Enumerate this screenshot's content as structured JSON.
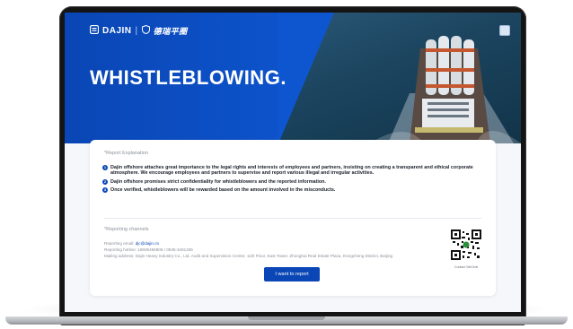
{
  "brand": {
    "logo_text": "DAJIN",
    "separator": "|",
    "logo_cn": "德瑞平圈"
  },
  "hero": {
    "title": "WHISTLEBLOWING",
    "title_dot": "."
  },
  "report_explanation": {
    "label": "*Report Explanation",
    "points": [
      {
        "num": "1",
        "text": "Dajin offshore attaches great importance to the legal rights and interests of employees and partners, insisting on creating a transparent and ethical corporate atmosphere. We encourage employees and partners to supervise and report various illegal and irregular activities."
      },
      {
        "num": "2",
        "text": "Dajin offshore promises strict confidentiality for whistleblowers and the reported information."
      },
      {
        "num": "3",
        "text": "Once verified, whistleblowers will be rewarded based on the amount involved in the misconducts."
      }
    ]
  },
  "reporting_channels": {
    "label": "*Reporting channels",
    "email_label": "Reporting email:",
    "email_value": "djc@dajin.cn",
    "hotline_label": "Reporting hotline:",
    "hotline_value": "18606456806 / 0535-3461336",
    "address_label": "Mailing address:",
    "address_value": "Dajin Heavy Industry Co., Ltd. Audit and Supervision Center, 11th Floor, East Tower, Zhonghai Real Estate Plaza, Dongcheng District, Beijing",
    "qr_caption": "Contact WeChat"
  },
  "actions": {
    "report_button": "I want to report"
  },
  "colors": {
    "brand_blue": "#0a46b5",
    "card_bg": "#ffffff",
    "text_dark": "#1a1f2b"
  }
}
